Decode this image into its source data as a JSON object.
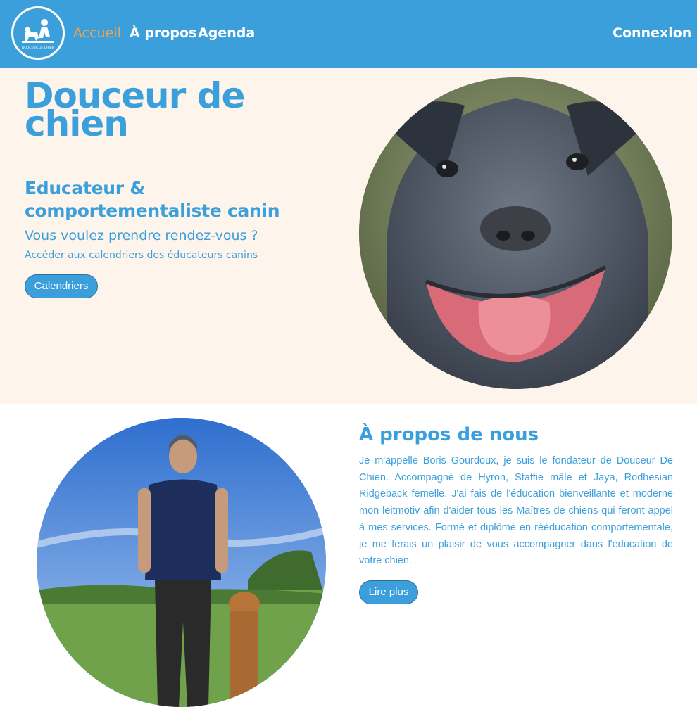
{
  "nav": {
    "logo_text": "DOUCEUR DE CHIEN",
    "links": [
      "Accueil",
      "À propos",
      "Agenda"
    ],
    "login": "Connexion"
  },
  "hero": {
    "title": "Douceur de chien",
    "subtitle": "Educateur & comportementaliste canin",
    "question": "Vous voulez prendre rendez-vous ?",
    "cta_text": "Accéder aux calendriers des éducateurs canins",
    "cta_button": "Calendriers"
  },
  "about": {
    "title": "À propos de nous",
    "text": "Je m'appelle Boris Gourdoux, je suis le fondateur de Douceur De Chien. Accompagné de Hyron, Staffie mâle et Jaya, Rodhesian Ridgeback femelle. J'ai fais de l'éducation bienveillante et moderne mon leitmotiv afin d'aider tous les Maîtres de chiens qui feront appel à mes services. Formé et diplômé en rééducation comportementale, je me ferais un plaisir de vous accompagner dans l'éducation de votre chien.",
    "button": "Lire plus"
  },
  "colors": {
    "primary": "#3b9fdb",
    "active_link": "#f2a54a",
    "hero_background": "#fdf4ec",
    "text_white": "#ffffff"
  }
}
